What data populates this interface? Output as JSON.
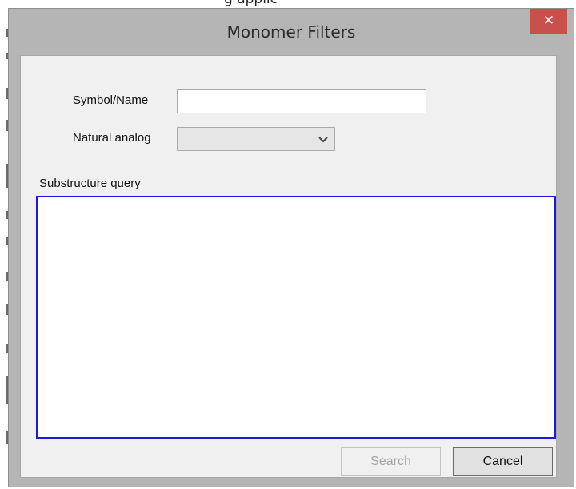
{
  "background": {
    "top_text": "g applic"
  },
  "window": {
    "title": "Monomer Filters",
    "close_glyph": "✕",
    "close_color": "#c7514a"
  },
  "form": {
    "symbol_label": "Symbol/Name",
    "symbol_value": "",
    "natural_analog_label": "Natural analog",
    "natural_analog_value": "",
    "substructure_label": "Substructure query",
    "query_border_color": "#1c1cd6"
  },
  "buttons": {
    "search_label": "Search",
    "search_enabled": false,
    "cancel_label": "Cancel"
  },
  "icons": {
    "close": "close-icon",
    "dropdown": "chevron-down-icon"
  }
}
